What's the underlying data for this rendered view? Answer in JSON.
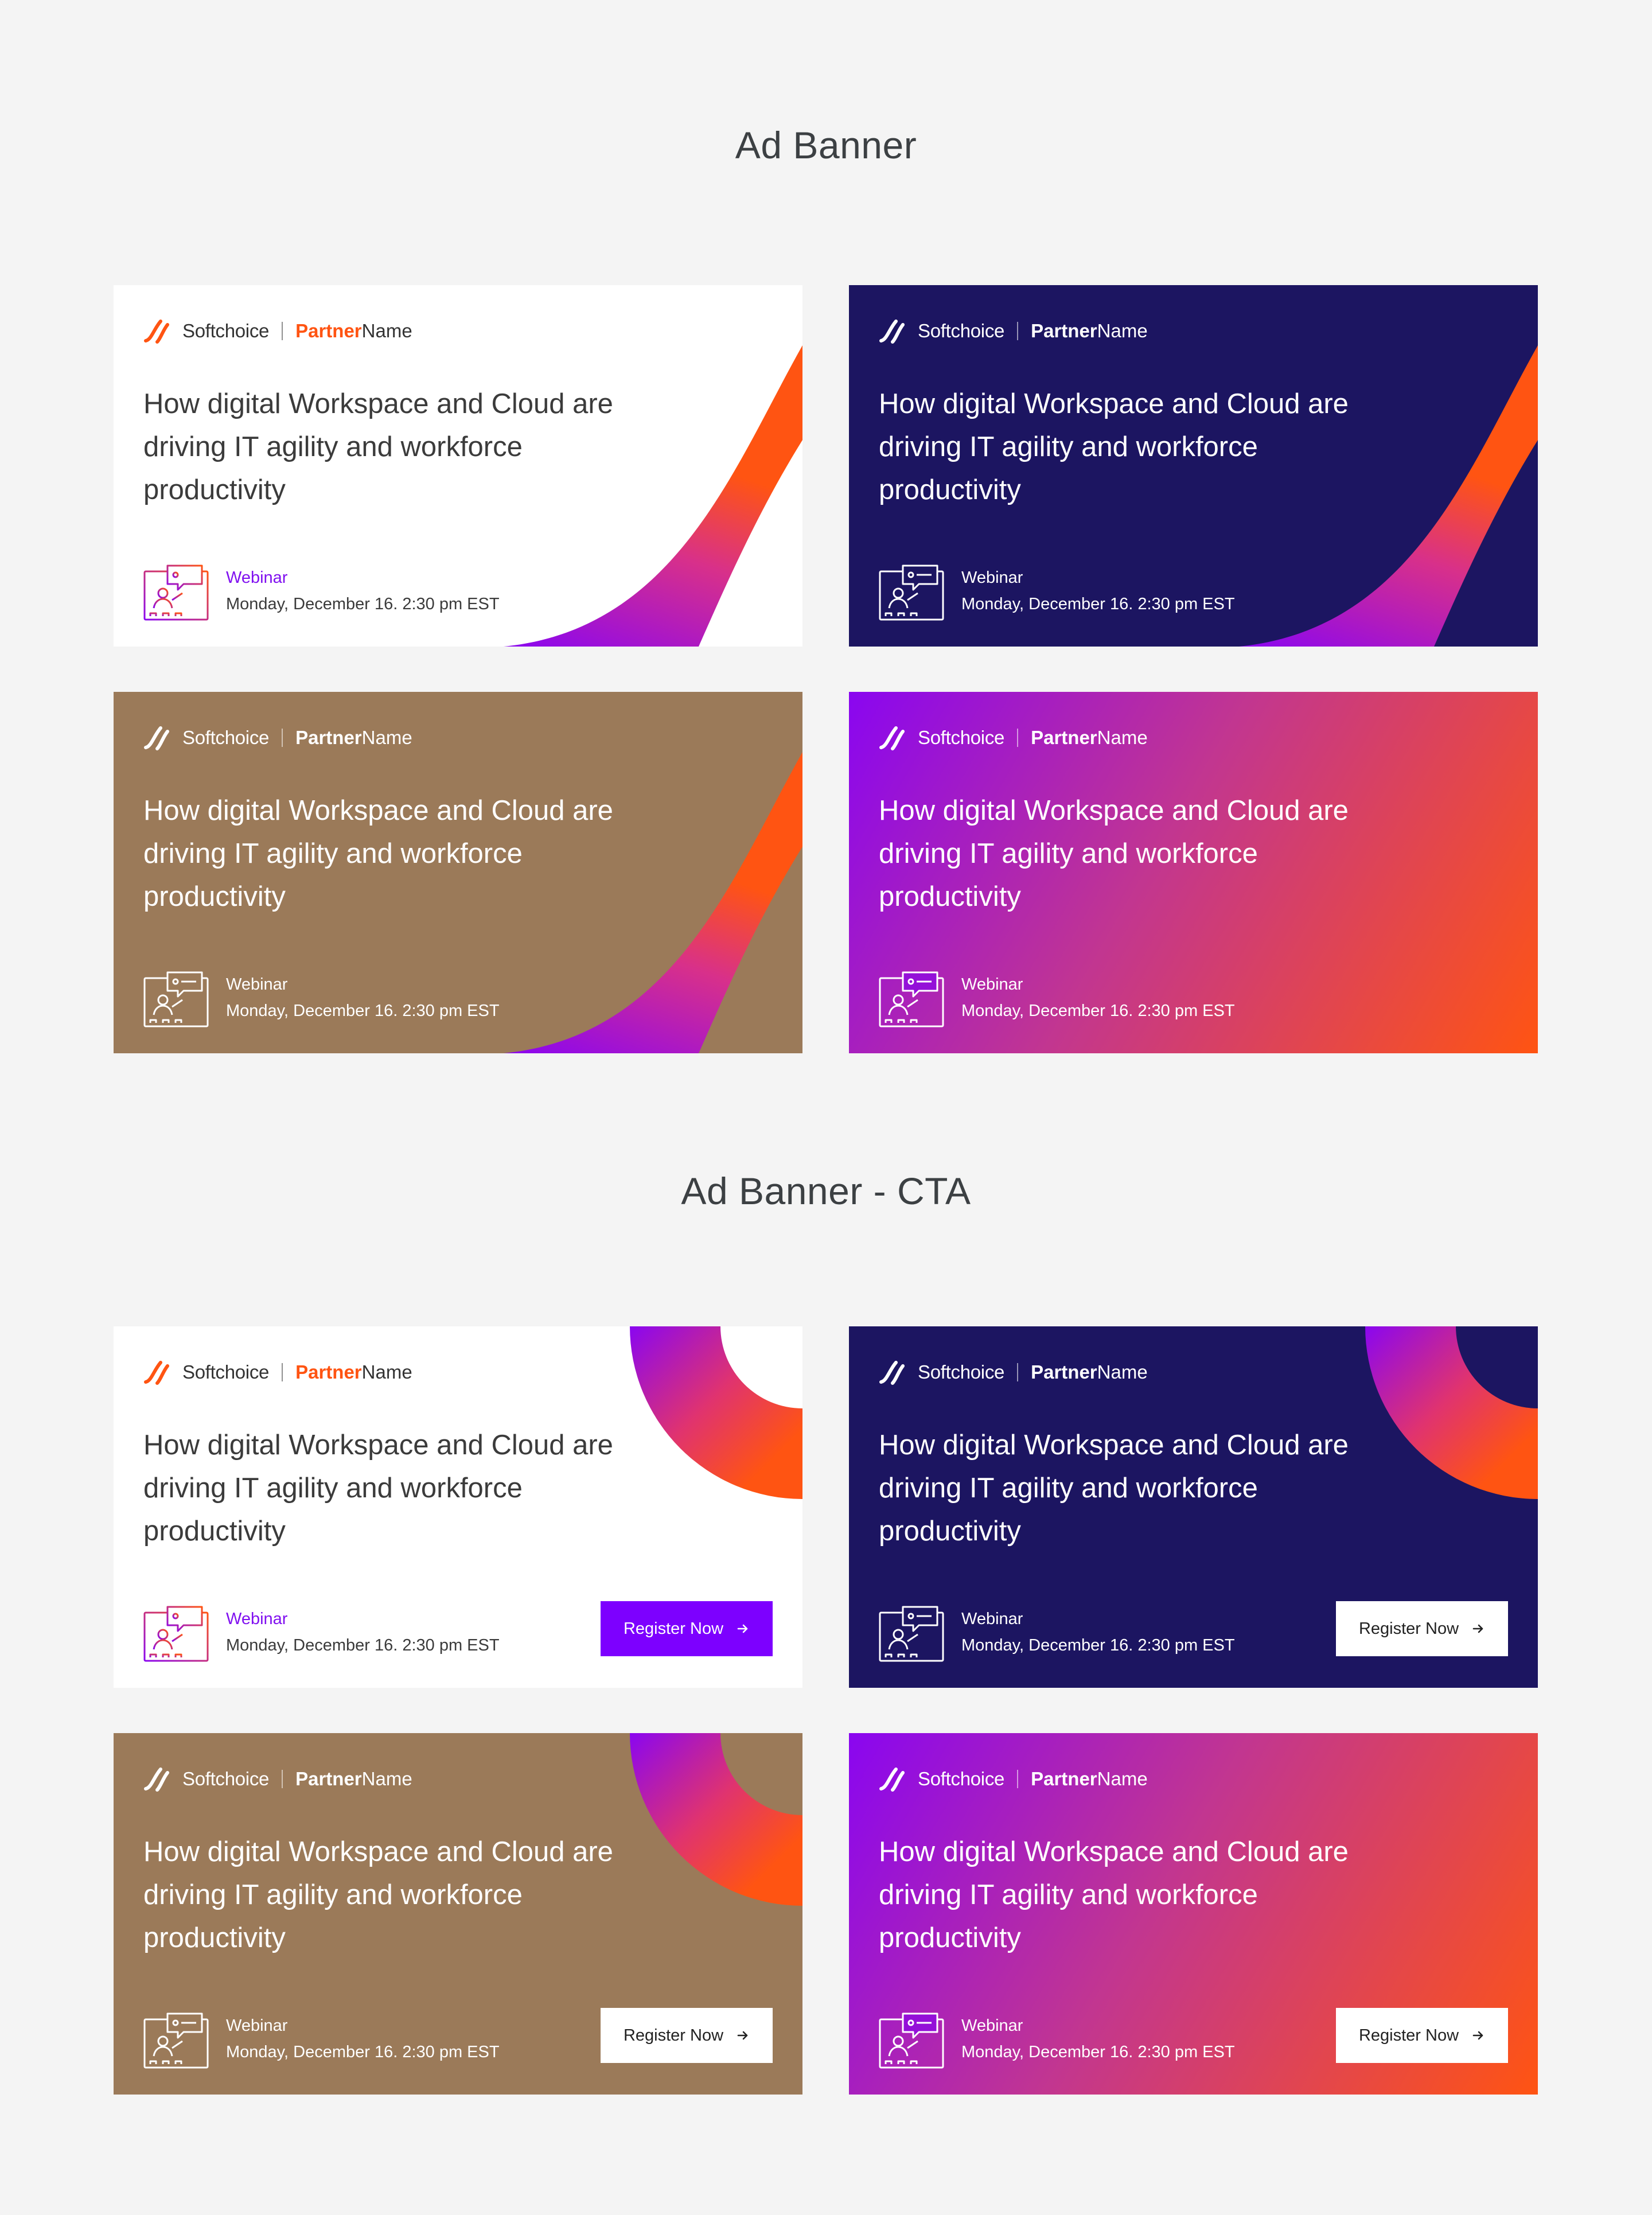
{
  "sections": [
    {
      "title": "Ad Banner"
    },
    {
      "title": "Ad Banner - CTA"
    }
  ],
  "brand": {
    "logo_text": "Softchoice",
    "partner_bold": "Partner",
    "partner_light": "Name",
    "colors": {
      "orange": "#ff5412",
      "purple": "#7d00ff",
      "navy": "#1c1561",
      "brown": "#9b7a59",
      "page_background": "#f4f4f4"
    }
  },
  "banner": {
    "headline": "How digital Workspace and Cloud are driving IT agility and workforce productivity",
    "event_type": "Webinar",
    "event_date": "Monday, December 16. 2:30 pm EST",
    "cta_label": "Register Now",
    "icons": {
      "logo": "softchoice-swoosh-icon",
      "event": "webinar-presenter-icon",
      "cta": "arrow-right-icon"
    }
  },
  "variants": [
    "white",
    "navy",
    "brown",
    "gradient"
  ]
}
